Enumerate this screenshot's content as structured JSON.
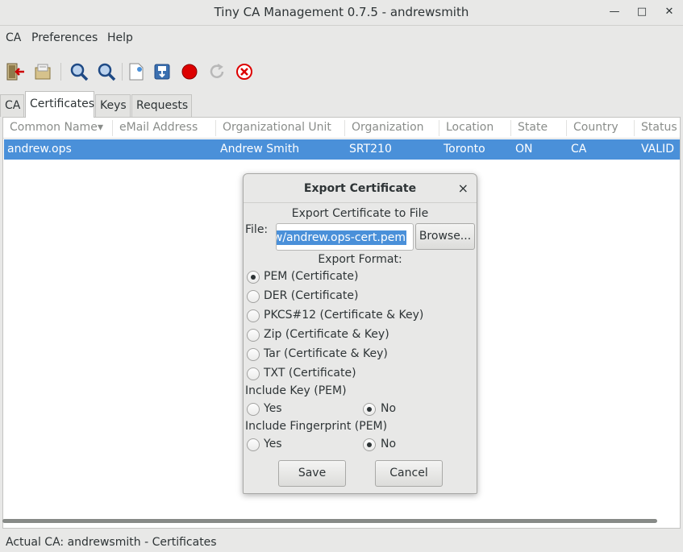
{
  "window": {
    "title": "Tiny CA Management 0.7.5 - andrewsmith",
    "minimize_glyph": "—",
    "maximize_glyph": "□",
    "close_glyph": "✕"
  },
  "menubar": {
    "items": [
      "CA",
      "Preferences",
      "Help"
    ]
  },
  "toolbar": {
    "icons": [
      "exit-icon",
      "open-ca-icon",
      "view-icon",
      "search-icon",
      "new-doc-icon",
      "import-icon",
      "revoke-icon",
      "renew-icon",
      "delete-icon"
    ]
  },
  "tabs": [
    "CA",
    "Certificates",
    "Keys",
    "Requests"
  ],
  "active_tab": "Certificates",
  "table": {
    "columns": [
      "Common Name",
      "eMail Address",
      "Organizational Unit",
      "Organization",
      "Location",
      "State",
      "Country",
      "Status"
    ],
    "sort_indicator": "▾",
    "rows": [
      {
        "common_name": "andrew.ops",
        "email": "",
        "ou": "Andrew Smith",
        "org": "SRT210",
        "location": "Toronto",
        "state": "ON",
        "country": "CA",
        "status": "VALID"
      }
    ],
    "selection_color": "#4a90d9"
  },
  "statusbar": {
    "text": "Actual CA: andrewsmith - Certificates"
  },
  "dialog": {
    "title": "Export Certificate",
    "close_glyph": "×",
    "heading": "Export Certificate to File",
    "file_label": "File:",
    "file_value": "ew/andrew.ops-cert.pem",
    "browse_label": "Browse...",
    "format_label": "Export Format:",
    "formats": [
      {
        "label": "PEM (Certificate)",
        "checked": true
      },
      {
        "label": "DER (Certificate)",
        "checked": false
      },
      {
        "label": "PKCS#12 (Certificate & Key)",
        "checked": false
      },
      {
        "label": "Zip (Certificate & Key)",
        "checked": false
      },
      {
        "label": "Tar (Certificate & Key)",
        "checked": false
      },
      {
        "label": "TXT (Certificate)",
        "checked": false
      }
    ],
    "include_key_label": "Include Key (PEM)",
    "include_key": {
      "yes": "Yes",
      "no": "No",
      "selected": "No"
    },
    "include_fp_label": "Include Fingerprint (PEM)",
    "include_fp": {
      "yes": "Yes",
      "no": "No",
      "selected": "No"
    },
    "save_label": "Save",
    "cancel_label": "Cancel"
  }
}
